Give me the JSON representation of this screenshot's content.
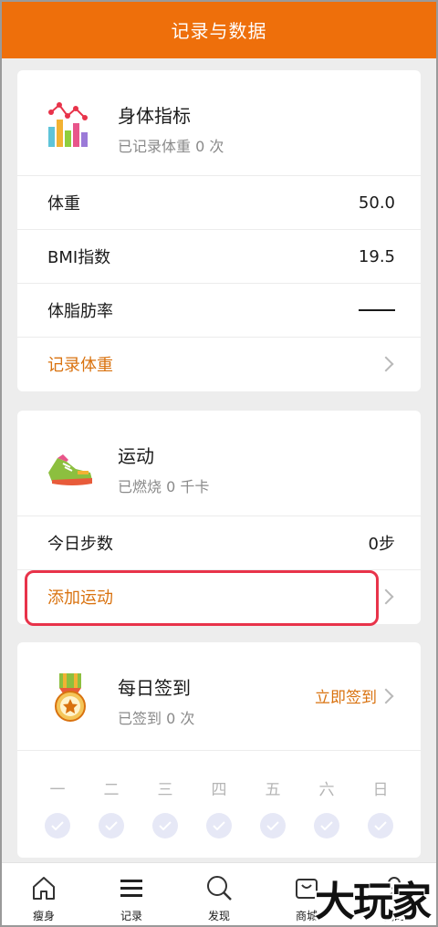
{
  "header": {
    "title": "记录与数据"
  },
  "body_card": {
    "title": "身体指标",
    "subtitle": "已记录体重 0 次",
    "rows": [
      {
        "label": "体重",
        "value": "50.0"
      },
      {
        "label": "BMI指数",
        "value": "19.5"
      },
      {
        "label": "体脂肪率",
        "value": ""
      }
    ],
    "action": "记录体重"
  },
  "exercise_card": {
    "title": "运动",
    "subtitle": "已燃烧 0 千卡",
    "steps_label": "今日步数",
    "steps_value": "0步",
    "action": "添加运动"
  },
  "checkin_card": {
    "title": "每日签到",
    "subtitle": "已签到 0 次",
    "button": "立即签到",
    "days": [
      "一",
      "二",
      "三",
      "四",
      "五",
      "六",
      "日"
    ]
  },
  "tabbar": {
    "items": [
      {
        "label": "瘦身",
        "icon": "home-icon"
      },
      {
        "label": "记录",
        "icon": "list-icon"
      },
      {
        "label": "发现",
        "icon": "search-icon"
      },
      {
        "label": "商城",
        "icon": "shop-icon"
      },
      {
        "label": "我的",
        "icon": "user-icon"
      }
    ]
  },
  "watermark": "大玩家",
  "colors": {
    "accent": "#ee6f0b",
    "link": "#d9720f",
    "highlight": "#e8334a"
  }
}
